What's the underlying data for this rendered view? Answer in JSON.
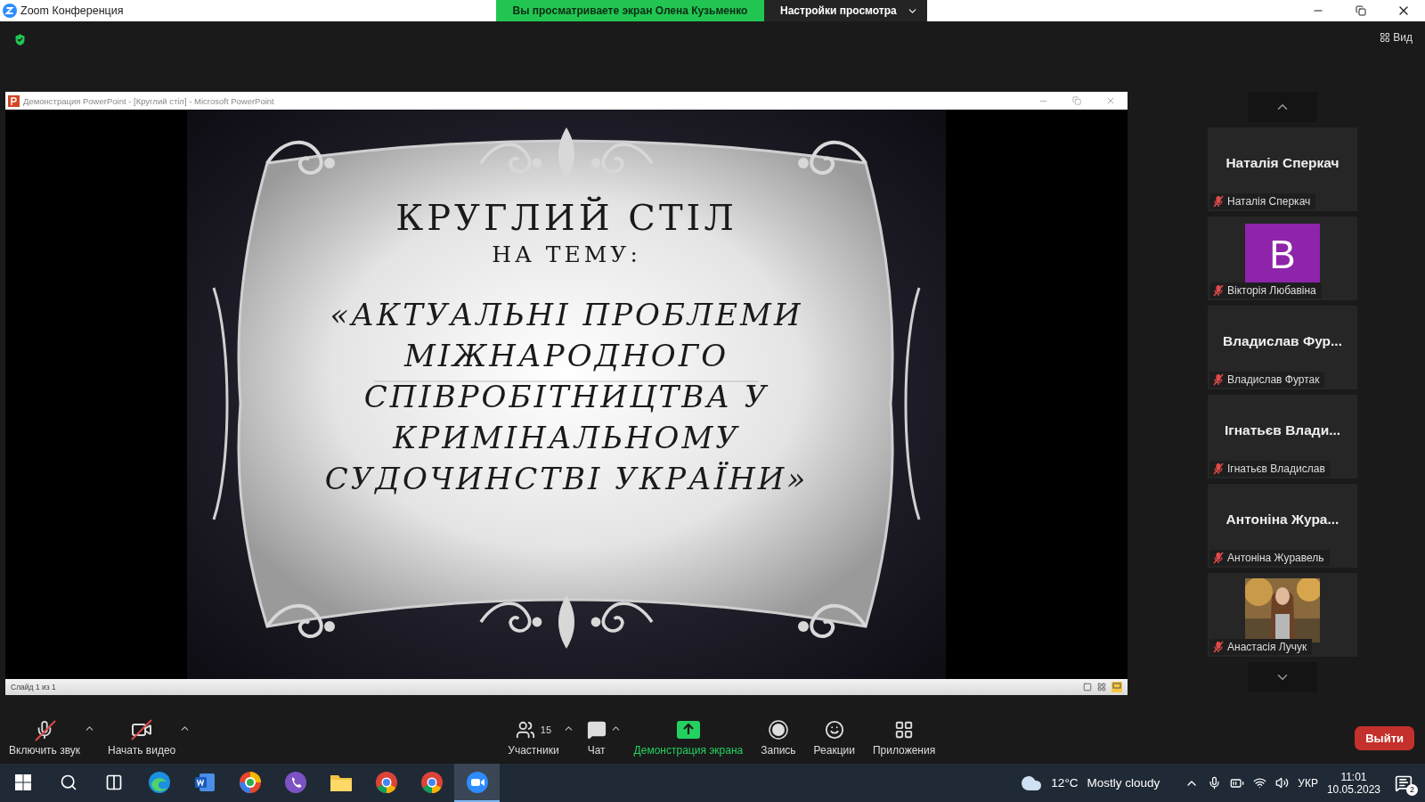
{
  "window": {
    "title": "Zoom Конференция"
  },
  "share_banner": {
    "text": "Вы просматриваете экран Олена Кузьменко",
    "options": "Настройки просмотра"
  },
  "view_button": {
    "label": "Вид"
  },
  "presentation": {
    "title": "Демонстрация PowerPoint - [Круглий стіл] - Microsoft PowerPoint",
    "status": "Слайд 1 из 1",
    "slide": {
      "title": "КРУГЛИЙ СТІЛ",
      "subtitle": "НА ТЕМУ:",
      "topic": "«АКТУАЛЬНІ ПРОБЛЕМИ\nМІЖНАРОДНОГО\nСПІВРОБІТНИЦТВА У\nКРИМІНАЛЬНОМУ\nСУДОЧИНСТВІ УКРАЇНИ»"
    }
  },
  "participants": [
    {
      "kind": "name",
      "display": "Наталія Сперкач",
      "name": "Наталія Сперкач",
      "muted": true
    },
    {
      "kind": "letter",
      "display": "В",
      "color": "#8e24aa",
      "name": "Вікторія Любавіна",
      "muted": true
    },
    {
      "kind": "name",
      "display": "Владислав  Фур...",
      "name": "Владислав Фуртак",
      "muted": true
    },
    {
      "kind": "name",
      "display": "Ігнатьєв  Влади...",
      "name": "Ігнатьєв Владислав",
      "muted": true
    },
    {
      "kind": "name",
      "display": "Антоніна Жура...",
      "name": "Антоніна Журавель",
      "muted": true
    },
    {
      "kind": "picture",
      "name": "Анастасія Лучук",
      "muted": true
    }
  ],
  "toolbar": [
    {
      "kind": "mic",
      "label": "Включить звук",
      "off": true,
      "highlighted": false,
      "menu": true
    },
    {
      "kind": "video",
      "label": "Начать видео",
      "off": true,
      "highlighted": false,
      "menu": true
    },
    {
      "kind": "participants",
      "label": "Участники",
      "count": "15",
      "off": false,
      "highlighted": false,
      "menu": true
    },
    {
      "kind": "chat",
      "label": "Чат",
      "off": false,
      "highlighted": false,
      "menu": true
    },
    {
      "kind": "share",
      "label": "Демонстрация экрана",
      "off": false,
      "highlighted": true,
      "menu": false
    },
    {
      "kind": "record",
      "label": "Запись",
      "off": false,
      "highlighted": false,
      "menu": false
    },
    {
      "kind": "reactions",
      "label": "Реакции",
      "off": false,
      "highlighted": false,
      "menu": false
    },
    {
      "kind": "apps",
      "label": "Приложения",
      "off": false,
      "highlighted": false,
      "menu": false
    }
  ],
  "leave_button": {
    "label": "Выйти"
  },
  "taskbar": {
    "apps": [
      {
        "kind": "search",
        "selected": false
      },
      {
        "kind": "taskview",
        "selected": false
      },
      {
        "kind": "edge",
        "selected": false
      },
      {
        "kind": "word",
        "selected": false
      },
      {
        "kind": "browser",
        "selected": false
      },
      {
        "kind": "viber",
        "selected": false
      },
      {
        "kind": "folder",
        "selected": false
      },
      {
        "kind": "chrome",
        "selected": false
      },
      {
        "kind": "chrome",
        "selected": false
      },
      {
        "kind": "zoom",
        "selected": true
      }
    ],
    "weather": {
      "temp": "12°C",
      "text": "Mostly cloudy"
    },
    "language": "УКР",
    "time": "11:01",
    "date": "10.05.2023",
    "notifications": "2"
  }
}
